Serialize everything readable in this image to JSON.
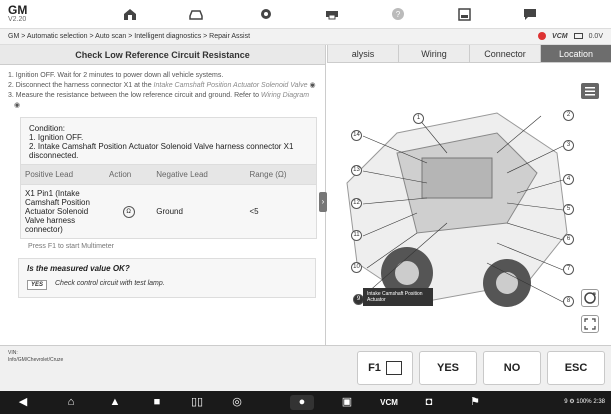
{
  "header": {
    "brand": "GM",
    "version": "V2.20"
  },
  "toolbar": {
    "icons": [
      "home-icon",
      "vehicle-icon",
      "gear-icon",
      "printer-icon",
      "help-icon",
      "save-icon",
      "message-icon"
    ]
  },
  "breadcrumb": "GM > Automatic selection > Auto scan > Intelligent diagnostics > Repair Assist",
  "status": {
    "vci": "VCM",
    "voltage": "0.0V"
  },
  "left": {
    "title": "Check Low Reference Circuit Resistance",
    "steps": [
      {
        "text": "1. Ignition OFF. Wait for 2 minutes to power down all vehicle systems.",
        "link": ""
      },
      {
        "text": "2. Disconnect the harness connector X1 at the ",
        "link": "Intake Camshaft Position Actuator Solenoid Valve"
      },
      {
        "text": "3. Measure the resistance between the low reference circuit and ground. Refer to ",
        "link": "Wiring Diagram"
      }
    ],
    "condition": {
      "title": "Condition:",
      "lines": [
        "1. Ignition OFF.",
        "2. Intake Camshaft Position Actuator Solenoid Valve harness connector X1 disconnected."
      ]
    },
    "table": {
      "headers": [
        "Positive Lead",
        "Action",
        "Negative Lead",
        "Range (Ω)"
      ],
      "row": [
        "X1 Pin1 (Intake Camshaft Position Actuator Solenoid Valve harness connector)",
        "Ω",
        "Ground",
        "<5"
      ]
    },
    "press": "Press F1 to start Multimeter",
    "question": {
      "text": "Is the measured value OK?",
      "yes": "YES",
      "answer": "Check control circuit with test lamp."
    }
  },
  "tabs": [
    {
      "label": "alysis",
      "active": false
    },
    {
      "label": "Wiring",
      "active": false
    },
    {
      "label": "Connector",
      "active": false
    },
    {
      "label": "Location",
      "active": true
    }
  ],
  "callouts": [
    "1",
    "2",
    "3",
    "4",
    "5",
    "6",
    "7",
    "8",
    "9",
    "10",
    "11",
    "12",
    "13",
    "14"
  ],
  "location_tag": "Intake Camshaft Position Actuator",
  "footer": {
    "vin_label": "VIN:",
    "vehicle_path": "Info/GM/Chevrolet/Cruze",
    "f1": "F1",
    "yes": "YES",
    "no": "NO",
    "esc": "ESC"
  },
  "navbar": {
    "status": "9 ⚙ 100% 2:38"
  }
}
